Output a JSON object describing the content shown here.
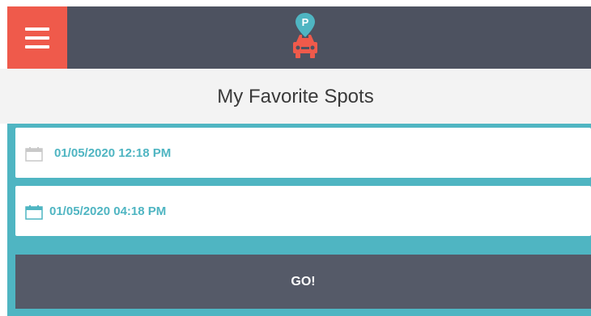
{
  "header": {
    "menu_icon": "hamburger-icon",
    "logo_icon": "car-parking-pin-icon",
    "logo_pin_letter": "P",
    "colors": {
      "bar": "#4d5260",
      "menu": "#ef5a4b",
      "accent": "#4fb5c2"
    }
  },
  "page": {
    "title": "My Favorite Spots"
  },
  "form": {
    "start_datetime": "01/05/2020 12:18 PM",
    "end_datetime": "01/05/2020 04:18 PM",
    "calendar_icon": "calendar-icon",
    "go_label": "GO!"
  }
}
